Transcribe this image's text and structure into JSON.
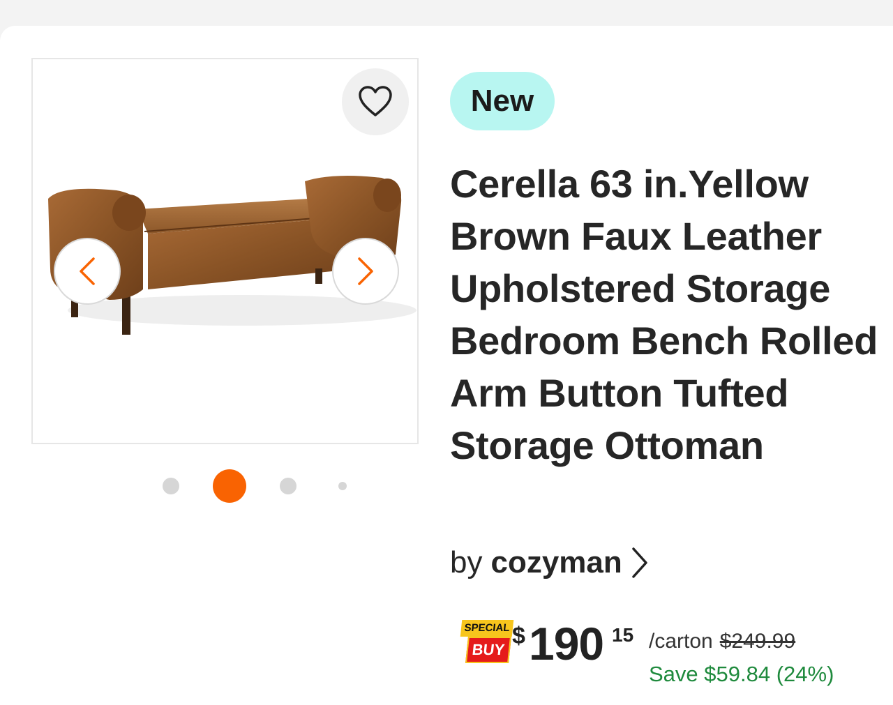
{
  "product": {
    "badge": "New",
    "title": "Cerella 63 in.Yellow Brown Faux Leather Upholstered Storage Bedroom Bench Rolled Arm Button Tufted Storage Ottoman",
    "by_label": "by",
    "brand": "cozyman",
    "image_alt": "Cerella storage bench"
  },
  "gallery": {
    "slide_count": 4,
    "active_index": 1
  },
  "pricing": {
    "special_top": "SPECIAL",
    "special_bottom": "BUY",
    "currency": "$",
    "dollars": "190",
    "cents": "15",
    "unit": "/carton",
    "was_price": "$249.99",
    "savings": "Save $59.84 (24%)"
  },
  "icons": {
    "favorite": "heart-outline-icon",
    "prev": "chevron-left-icon",
    "next": "chevron-right-icon",
    "brand_link": "chevron-right-icon"
  },
  "colors": {
    "accent": "#f96302",
    "badge_bg": "#b8f6f1",
    "save_green": "#1f8a3d"
  }
}
